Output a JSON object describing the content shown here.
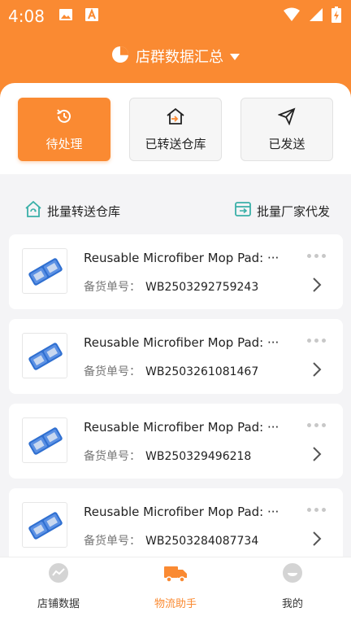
{
  "status_bar": {
    "time": "4:08"
  },
  "header": {
    "title": "店群数据汇总"
  },
  "tabs": [
    {
      "label": "待处理",
      "icon": "history-icon",
      "active": true
    },
    {
      "label": "已转送仓库",
      "icon": "warehouse-transfer-icon",
      "active": false
    },
    {
      "label": "已发送",
      "icon": "send-icon",
      "active": false
    }
  ],
  "batch_actions": {
    "warehouse": "批量转送仓库",
    "factory": "批量厂家代发"
  },
  "items": [
    {
      "title": "Reusable Microfiber Mop Pad: ···",
      "order_label": "备货单号：",
      "order_no": "WB2503292759243"
    },
    {
      "title": "Reusable Microfiber Mop Pad: ···",
      "order_label": "备货单号：",
      "order_no": "WB2503261081467"
    },
    {
      "title": "Reusable Microfiber Mop Pad: ···",
      "order_label": "备货单号：",
      "order_no": "WB250329496218"
    },
    {
      "title": "Reusable Microfiber Mop Pad: ···",
      "order_label": "备货单号：",
      "order_no": "WB2503284087734"
    }
  ],
  "bottom_nav": [
    {
      "label": "店铺数据",
      "icon": "chart-icon",
      "active": false
    },
    {
      "label": "物流助手",
      "icon": "truck-icon",
      "active": true
    },
    {
      "label": "我的",
      "icon": "profile-icon",
      "active": false
    }
  ],
  "colors": {
    "accent": "#fa8a32",
    "background": "#f4f4f6"
  }
}
